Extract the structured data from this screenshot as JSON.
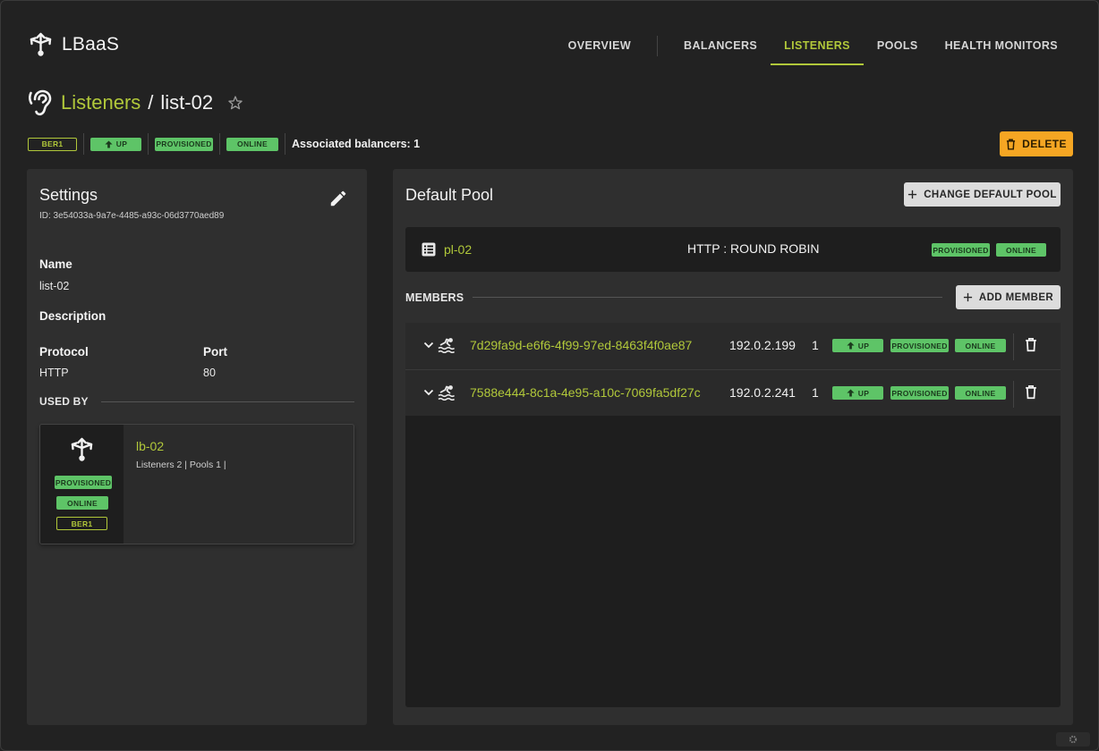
{
  "app": {
    "name": "LBaaS",
    "nav": [
      {
        "label": "OVERVIEW"
      },
      {
        "label": "BALANCERS"
      },
      {
        "label": "LISTENERS"
      },
      {
        "label": "POOLS"
      },
      {
        "label": "HEALTH MONITORS"
      }
    ],
    "active_nav": "LISTENERS"
  },
  "breadcrumb": {
    "parent": "Listeners",
    "separator": "/",
    "current": "list-02"
  },
  "status": {
    "region": "BER1",
    "admin_state": "UP",
    "provisioning": "PROVISIONED",
    "operating": "ONLINE",
    "associated": "Associated balancers: 1"
  },
  "actions": {
    "delete": "DELETE"
  },
  "settings": {
    "title": "Settings",
    "id": "ID: 3e54033a-9a7e-4485-a93c-06d3770aed89",
    "name_label": "Name",
    "name_value": "list-02",
    "description_label": "Description",
    "protocol_label": "Protocol",
    "protocol_value": "HTTP",
    "port_label": "Port",
    "port_value": "80",
    "used_by_label": "USED BY"
  },
  "used_by": {
    "name": "lb-02",
    "meta": "Listeners 2 | Pools 1 |",
    "provisioning": "PROVISIONED",
    "operating": "ONLINE",
    "region": "BER1"
  },
  "default_pool": {
    "title": "Default Pool",
    "change_button": "CHANGE DEFAULT POOL",
    "name": "pl-02",
    "protocol": "HTTP : ROUND ROBIN",
    "provisioning": "PROVISIONED",
    "operating": "ONLINE"
  },
  "members": {
    "label": "MEMBERS",
    "add_button": "ADD MEMBER",
    "items": [
      {
        "id": "7d29fa9d-e6f6-4f99-97ed-8463f4f0ae87",
        "ip": "192.0.2.199",
        "weight": "1",
        "admin_state": "UP",
        "provisioning": "PROVISIONED",
        "operating": "ONLINE"
      },
      {
        "id": "7588e444-8c1a-4e95-a10c-7069fa5df27c",
        "ip": "192.0.2.241",
        "weight": "1",
        "admin_state": "UP",
        "provisioning": "PROVISIONED",
        "operating": "ONLINE"
      }
    ]
  },
  "colors": {
    "accent": "#b1c83a",
    "status_green": "#5ec467",
    "delete": "#f5a623",
    "background": "#222222",
    "panel": "#2f2f2f"
  },
  "icons": [
    "balancer-icon",
    "ear-icon",
    "star-icon",
    "arrow-up-icon",
    "trash-icon",
    "pencil-icon",
    "plus-icon",
    "list-icon",
    "chevron-down-icon",
    "swimmer-icon"
  ]
}
